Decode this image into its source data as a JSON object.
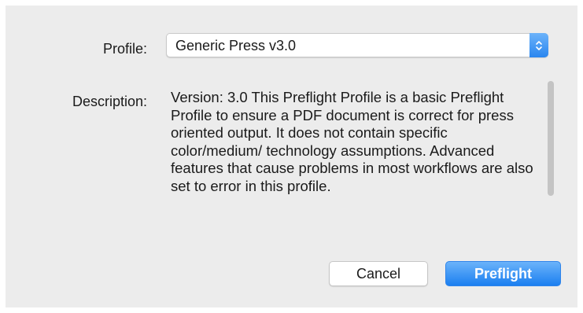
{
  "dialog": {
    "profile_label": "Profile:",
    "description_label": "Description:",
    "profile_select": {
      "selected": "Generic Press v3.0"
    },
    "description_text": "Version: 3.0 This Preflight Profile is a basic Preflight Profile to ensure a PDF document is correct for press oriented output. It does not contain specific color/medium/ technology assumptions. Advanced features that cause problems in most workflows are also set to error in this profile.",
    "buttons": {
      "cancel_label": "Cancel",
      "preflight_label": "Preflight"
    }
  },
  "colors": {
    "accent": "#2a86ef",
    "dialog_background": "#ececec"
  },
  "icons": {
    "select_stepper": "up-down-chevron-icon"
  }
}
